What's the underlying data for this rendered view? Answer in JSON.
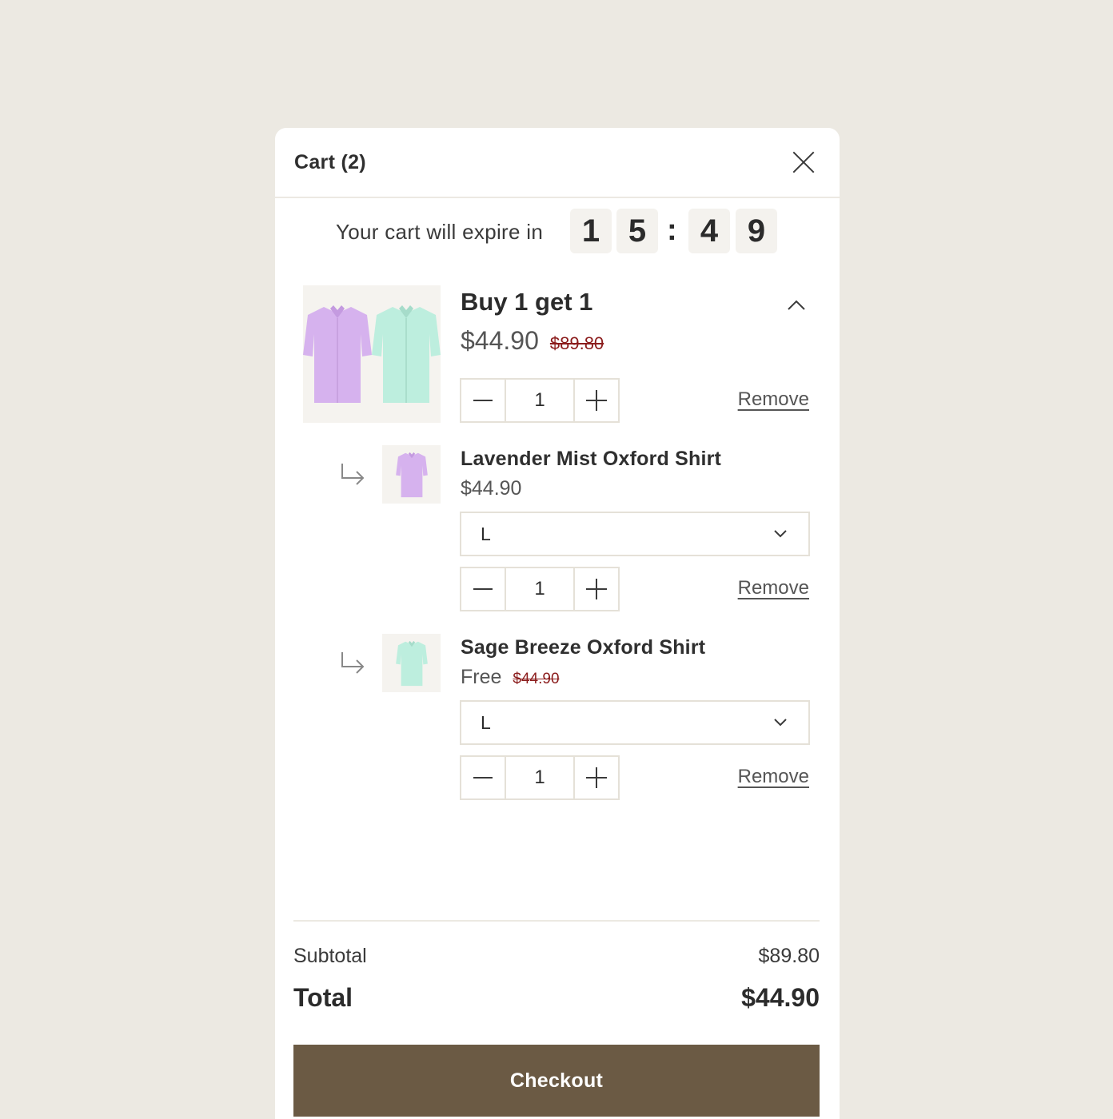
{
  "header": {
    "title": "Cart (2)"
  },
  "timer": {
    "label": "Your cart will expire in",
    "digits": [
      "1",
      "5",
      "4",
      "9"
    ],
    "separator": ":"
  },
  "bundle": {
    "title": "Buy 1 get 1",
    "price": "$44.90",
    "original_price": "$89.80",
    "quantity": "1",
    "remove_label": "Remove",
    "icon": "chevron-up-icon"
  },
  "items": [
    {
      "name": "Lavender Mist Oxford Shirt",
      "price": "$44.90",
      "original_price": "",
      "size": "L",
      "quantity": "1",
      "remove_label": "Remove",
      "color": "#d9b8ee"
    },
    {
      "name": "Sage Breeze Oxford Shirt",
      "price": "Free",
      "original_price": "$44.90",
      "size": "L",
      "quantity": "1",
      "remove_label": "Remove",
      "color": "#bdeede"
    }
  ],
  "summary": {
    "subtotal_label": "Subtotal",
    "subtotal": "$89.80",
    "total_label": "Total",
    "total": "$44.90"
  },
  "checkout": {
    "label": "Checkout",
    "color": "#6b5a44"
  }
}
